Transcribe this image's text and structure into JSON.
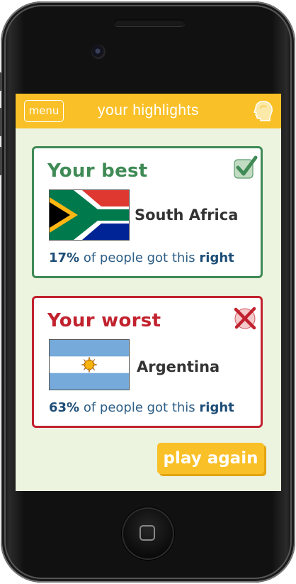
{
  "header": {
    "menu_label": "menu",
    "title": "your highlights",
    "icon": "head-icon"
  },
  "best": {
    "title": "Your best",
    "country": "South Africa",
    "percent": "17%",
    "stat_middle": " of people got this ",
    "stat_end": "right",
    "mark_icon": "checkmark-icon",
    "flag_icon": "south-africa-flag"
  },
  "worst": {
    "title": "Your worst",
    "country": "Argentina",
    "percent": "63%",
    "stat_middle": " of people got this ",
    "stat_end": "right",
    "mark_icon": "cross-icon",
    "flag_icon": "argentina-flag"
  },
  "play_again_label": "play again",
  "colors": {
    "header": "#f9c028",
    "screen_bg": "#ecf3df",
    "best": "#3f8a55",
    "worst": "#c1222e",
    "stat_text": "#2d5e86"
  }
}
